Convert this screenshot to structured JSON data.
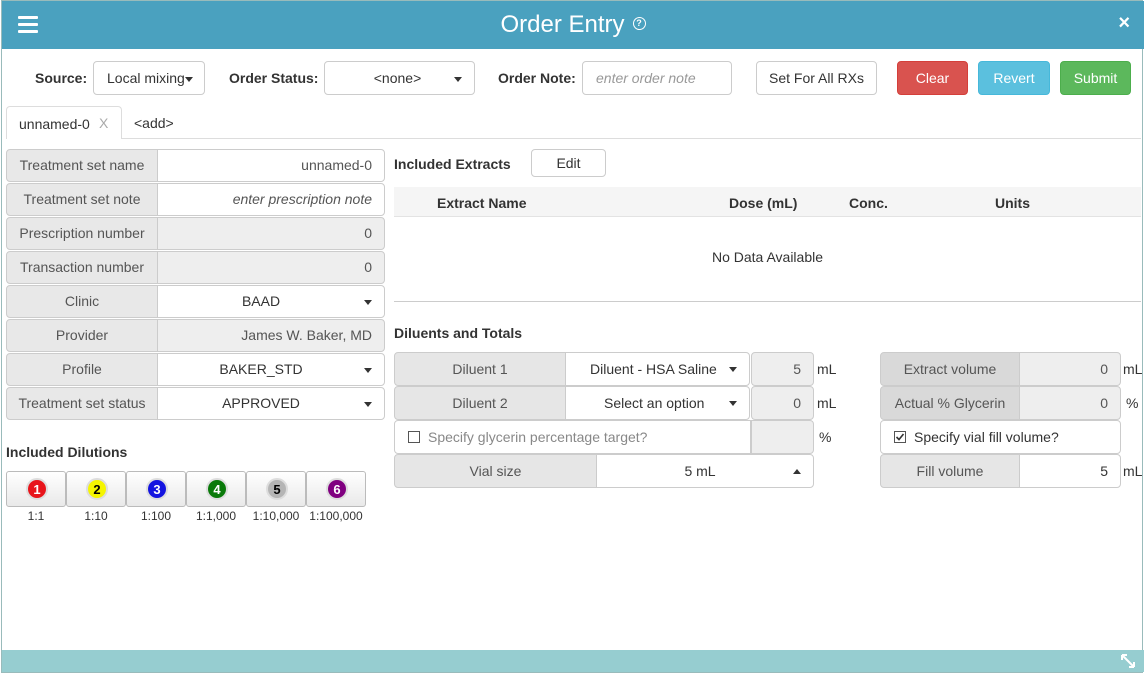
{
  "header": {
    "title": "Order Entry",
    "close": "×"
  },
  "toolbar": {
    "source_label": "Source:",
    "source_value": "Local mixing",
    "status_label": "Order Status:",
    "status_value": "<none>",
    "note_label": "Order Note:",
    "note_placeholder": "enter order note",
    "set_all": "Set For All RXs",
    "clear": "Clear",
    "revert": "Revert",
    "submit": "Submit"
  },
  "tabs": {
    "active": "unnamed-0",
    "active_close": "X",
    "add": "<add>"
  },
  "form": {
    "treatment_set_name": {
      "label": "Treatment set name",
      "value": "unnamed-0"
    },
    "treatment_set_note": {
      "label": "Treatment set note",
      "placeholder": "enter prescription note"
    },
    "prescription_number": {
      "label": "Prescription number",
      "value": "0"
    },
    "transaction_number": {
      "label": "Transaction number",
      "value": "0"
    },
    "clinic": {
      "label": "Clinic",
      "value": "BAAD"
    },
    "provider": {
      "label": "Provider",
      "value": "James W. Baker, MD"
    },
    "profile": {
      "label": "Profile",
      "value": "BAKER_STD"
    },
    "status": {
      "label": "Treatment set status",
      "value": "APPROVED"
    }
  },
  "dilutions": {
    "title": "Included Dilutions",
    "items": [
      {
        "num": "1",
        "label": "1:1",
        "color": "#e8141b",
        "text_color": "#ffffff"
      },
      {
        "num": "2",
        "label": "1:10",
        "color": "#f5f500",
        "text_color": "#000000"
      },
      {
        "num": "3",
        "label": "1:100",
        "color": "#1414e0",
        "text_color": "#ffffff"
      },
      {
        "num": "4",
        "label": "1:1,000",
        "color": "#0a7a0a",
        "text_color": "#ffffff"
      },
      {
        "num": "5",
        "label": "1:10,000",
        "color": "#b5b5b5",
        "text_color": "#000000"
      },
      {
        "num": "6",
        "label": "1:100,000",
        "color": "#800080",
        "text_color": "#ffffff"
      }
    ]
  },
  "extracts": {
    "title": "Included Extracts",
    "edit": "Edit",
    "columns": [
      "Extract Name",
      "Dose (mL)",
      "Conc.",
      "Units"
    ],
    "empty": "No Data Available"
  },
  "diluents": {
    "title": "Diluents and Totals",
    "d1_label": "Diluent 1",
    "d1_value": "Diluent - HSA Saline",
    "d1_amount": "5",
    "d1_unit": "mL",
    "d2_label": "Diluent 2",
    "d2_value": "Select an option",
    "d2_amount": "0",
    "d2_unit": "mL",
    "glycerin_check": "Specify glycerin percentage target?",
    "glycerin_unit": "%",
    "vial_label": "Vial size",
    "vial_value": "5 mL",
    "extract_volume_label": "Extract volume",
    "extract_volume": "0",
    "extract_volume_unit": "mL",
    "glycerin_pct_label": "Actual % Glycerin",
    "glycerin_pct": "0",
    "glycerin_pct_unit": "%",
    "fill_check": "Specify vial fill volume?",
    "fill_label": "Fill volume",
    "fill_value": "5",
    "fill_unit": "mL"
  }
}
